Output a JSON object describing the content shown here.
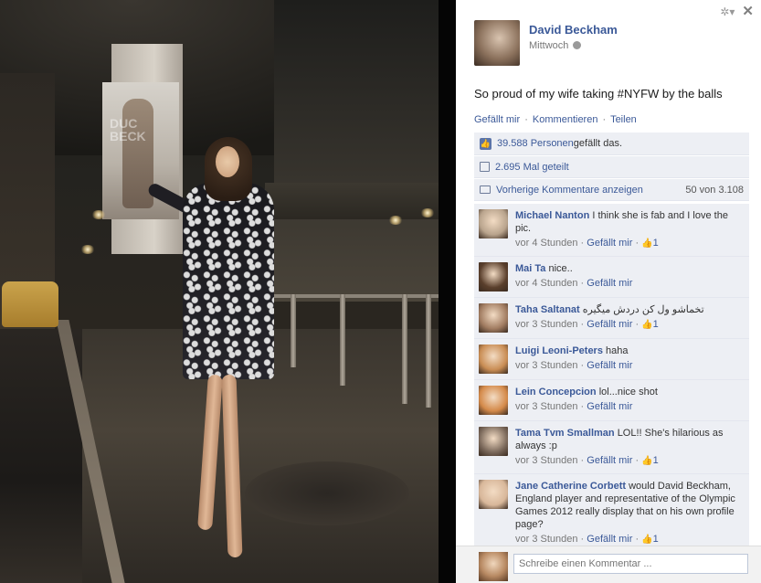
{
  "photo": {
    "billboard_text": "DUC BECK"
  },
  "panel": {
    "author": "David Beckham",
    "time": "Mittwoch",
    "post_text": "So proud of my wife taking #NYFW by the balls",
    "actions": {
      "like": "Gefällt mir",
      "comment": "Kommentieren",
      "share": "Teilen",
      "separator": "·"
    },
    "likes": {
      "count_link": "39.588 Personen",
      "suffix": " gefällt das."
    },
    "shares": {
      "count_link": "2.695 Mal geteilt"
    },
    "prev_comments": {
      "label": "Vorherige Kommentare anzeigen",
      "count": "50 von 3.108"
    },
    "comments": [
      {
        "name": "Michael Nanton",
        "text": "I think she is fab and I love the pic.",
        "time": "vor 4 Stunden",
        "like": "Gefällt mir",
        "likes": "1",
        "avatar_color": "#b9a48d"
      },
      {
        "name": "Mai Ta",
        "text": "nice..",
        "time": "vor 4 Stunden",
        "like": "Gefällt mir",
        "likes": "",
        "avatar_color": "#5a3f2c"
      },
      {
        "name": "Taha Saltanat",
        "text": "تخماشو ول کن دردش میگیره",
        "time": "vor 3 Stunden",
        "like": "Gefällt mir",
        "likes": "1",
        "avatar_color": "#a17c61"
      },
      {
        "name": "Luigi Leoni-Peters",
        "text": "haha",
        "time": "vor 3 Stunden",
        "like": "Gefällt mir",
        "likes": "",
        "avatar_color": "#c98d54"
      },
      {
        "name": "Lein Concepcion",
        "text": "lol...nice shot",
        "time": "vor 3 Stunden",
        "like": "Gefällt mir",
        "likes": "",
        "avatar_color": "#d48a4a"
      },
      {
        "name": "Tama Tvm Smallman",
        "text": "LOL!! She's hilarious as always :p",
        "time": "vor 3 Stunden",
        "like": "Gefällt mir",
        "likes": "1",
        "avatar_color": "#7c6a5c"
      },
      {
        "name": "Jane Catherine Corbett",
        "text": "would David Beckham, England player and representative of the Olympic Games 2012 really display that on his own profile page?",
        "time": "vor 3 Stunden",
        "like": "Gefällt mir",
        "likes": "1",
        "avatar_color": "#d8b79a"
      }
    ],
    "compose_placeholder": "Schreibe einen Kommentar ..."
  },
  "icons": {
    "gear": "gear-icon",
    "close": "close-icon",
    "globe": "globe-icon",
    "like": "thumbs-up-icon",
    "share": "share-icon",
    "comment": "comment-icon"
  }
}
